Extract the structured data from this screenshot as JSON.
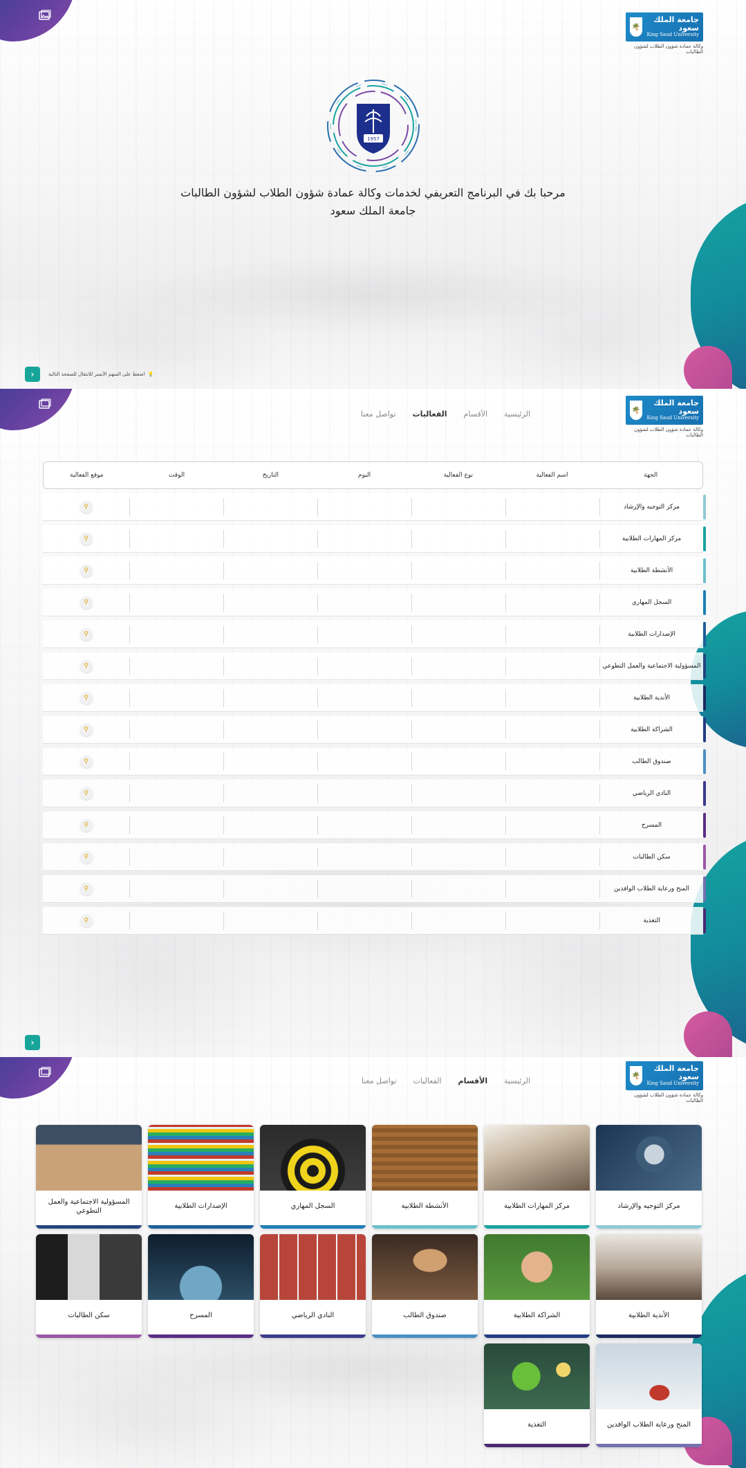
{
  "logo": {
    "arabic": "جامعة الملك سعود",
    "english": "King Saud University",
    "subtitle": "وكالة عمادة شؤون الطلاب لشؤون الطالبات",
    "emblem_year": "1957"
  },
  "hero": {
    "title_line1": "مرحبا بك في البرنامج التعريفي لخدمات وكالة عمادة شؤون الطلاب لشؤون الطالبات",
    "title_line2": "جامعة الملك سعود",
    "hint": "اضغط على السهم الأيسر للانتقال للصفحة التالية"
  },
  "nav": {
    "home": "الرئيسية",
    "sections": "الأقسام",
    "events": "الفعاليات",
    "contact": "تواصل معنا"
  },
  "events_table": {
    "headers": [
      "الجهة",
      "اسم الفعالية",
      "نوع الفعالية",
      "اليوم",
      "التاريخ",
      "الوقت",
      "موقع الفعالية"
    ],
    "rows": [
      {
        "entity": "مركز التوجيه والإرشاد",
        "color": "#8fc9d6"
      },
      {
        "entity": "مركز المهارات الطلابية",
        "color": "#19a3a0"
      },
      {
        "entity": "الأنشطة الطلابية",
        "color": "#6cc0cb"
      },
      {
        "entity": "السجل المهاري",
        "color": "#1f7fb5"
      },
      {
        "entity": "الإصدارات الطلابية",
        "color": "#1d5f9b"
      },
      {
        "entity": "المسؤولية الاجتماعية والعمل التطوعي",
        "color": "#23457f"
      },
      {
        "entity": "الأندية الطلابية",
        "color": "#1c2b5e"
      },
      {
        "entity": "الشراكة الطلابية",
        "color": "#223c84"
      },
      {
        "entity": "صندوق الطالب",
        "color": "#4b8fc4"
      },
      {
        "entity": "النادي الرياضي",
        "color": "#3b3b8e"
      },
      {
        "entity": "المسرح",
        "color": "#5b2e86"
      },
      {
        "entity": "سكن الطالبات",
        "color": "#9a58a6"
      },
      {
        "entity": "المنح ورعاية الطلاب الوافدين",
        "color": "#7570b0"
      },
      {
        "entity": "التغذية",
        "color": "#4a2a73"
      }
    ]
  },
  "departments": [
    {
      "label": "مركز التوجيه والإرشاد",
      "color": "#8fc9d6",
      "icon": "compass-photo"
    },
    {
      "label": "مركز المهارات الطلابية",
      "color": "#19a3a0",
      "icon": "meeting-photo"
    },
    {
      "label": "الأنشطة الطلابية",
      "color": "#6cc0cb",
      "icon": "lecture-hall-photo"
    },
    {
      "label": "السجل المهاري",
      "color": "#1f7fb5",
      "icon": "darts-target-photo"
    },
    {
      "label": "الإصدارات الطلابية",
      "color": "#1d5f9b",
      "icon": "books-photo"
    },
    {
      "label": "المسؤولية الاجتماعية والعمل التطوعي",
      "color": "#23457f",
      "icon": "beach-cleanup-photo"
    },
    {
      "label": "الأندية الطلابية",
      "color": "#1c2b5e",
      "icon": "students-photo"
    },
    {
      "label": "الشراكة الطلابية",
      "color": "#223c84",
      "icon": "hands-circle-photo"
    },
    {
      "label": "صندوق الطالب",
      "color": "#4b8fc4",
      "icon": "coins-jar-photo"
    },
    {
      "label": "النادي الرياضي",
      "color": "#3b3b8e",
      "icon": "running-track-photo"
    },
    {
      "label": "المسرح",
      "color": "#5b2e86",
      "icon": "stage-photo"
    },
    {
      "label": "سكن الطالبات",
      "color": "#9a58a6",
      "icon": "bunk-beds-photo"
    },
    {
      "label": "المنح ورعاية الطلاب الوافدين",
      "color": "#7570b0",
      "icon": "traveler-photo"
    },
    {
      "label": "التغذية",
      "color": "#4a2a73",
      "icon": "healthy-food-photo"
    }
  ]
}
